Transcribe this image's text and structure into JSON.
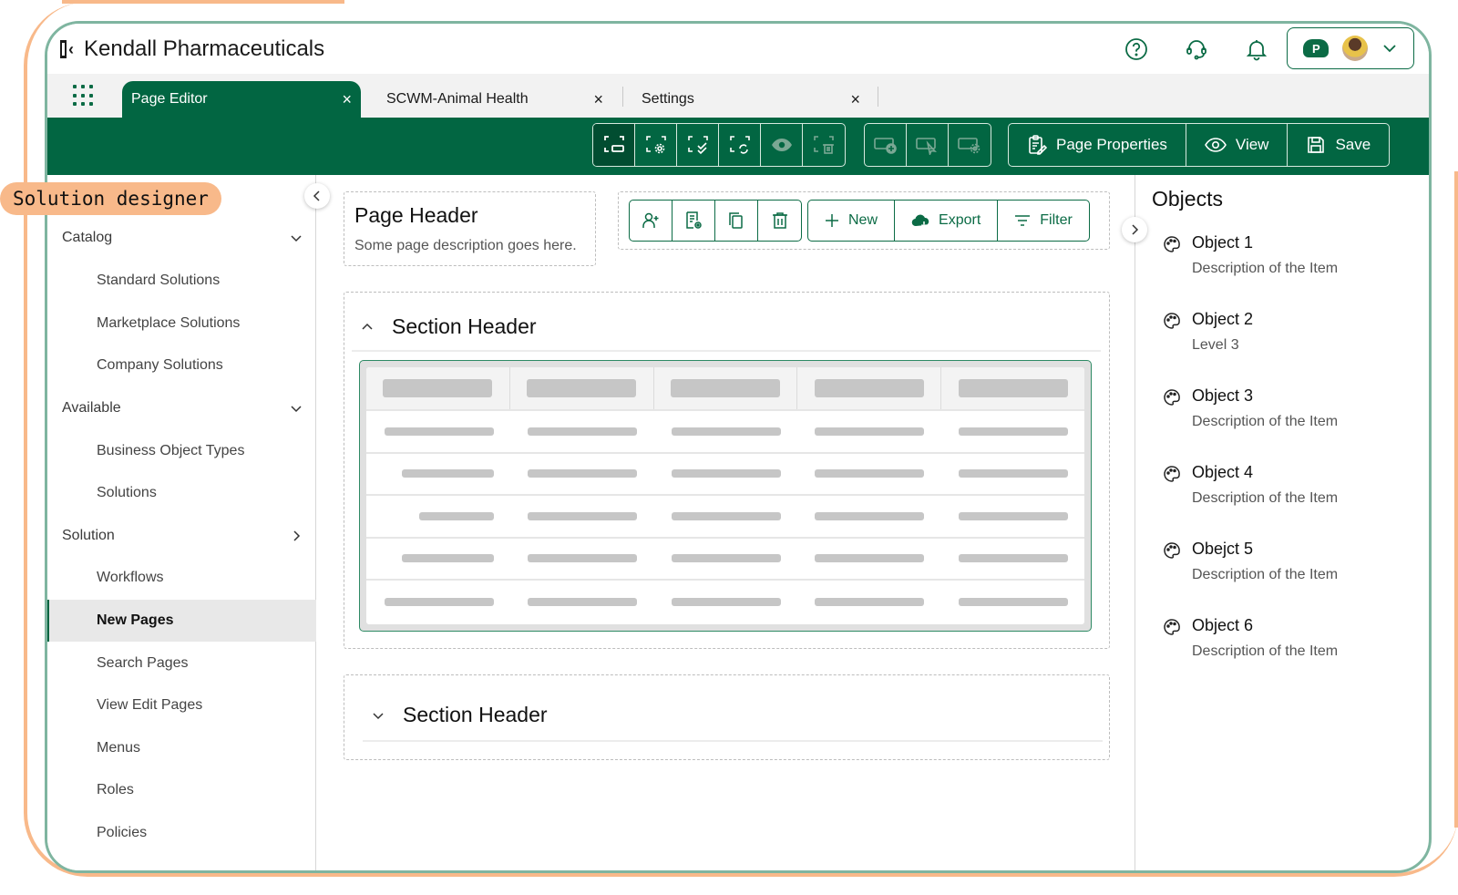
{
  "annotation": {
    "label": "Solution designer"
  },
  "header": {
    "brand": "Kendall Pharmaceuticals",
    "icons": [
      "help-icon",
      "support-headset-icon",
      "notification-bell-icon"
    ],
    "user_menu": {
      "cloud_badge": "P",
      "icon": "chevron-down-icon"
    }
  },
  "tabs": [
    {
      "label": "Page Editor",
      "active": true,
      "close": "×"
    },
    {
      "label": "SCWM-Animal Health",
      "active": false,
      "close": "×"
    },
    {
      "label": "Settings",
      "active": false,
      "close": "×"
    }
  ],
  "toolbar": {
    "layout_tools": [
      "select-field-icon",
      "field-settings-icon",
      "validate-field-icon",
      "refresh-field-icon",
      "preview-eye-icon",
      "delete-field-icon"
    ],
    "button_tools": [
      "add-button-icon",
      "select-button-icon",
      "button-settings-icon"
    ],
    "actions": {
      "page_properties": "Page Properties",
      "view": "View",
      "save": "Save"
    }
  },
  "sidebar": {
    "groups": [
      {
        "label": "Catalog",
        "expanded": true,
        "items": [
          "Standard Solutions",
          "Marketplace Solutions",
          "Company Solutions"
        ]
      },
      {
        "label": "Available",
        "expanded": true,
        "items": [
          "Business Object Types",
          "Solutions"
        ]
      },
      {
        "label": "Solution",
        "expanded": false,
        "items": [
          "Workflows",
          "New Pages",
          "Search Pages",
          "View Edit Pages",
          "Menus",
          "Roles",
          "Policies"
        ]
      }
    ],
    "active_item": "New Pages"
  },
  "page_header": {
    "title": "Page Header",
    "description": "Some page description goes here."
  },
  "page_actions": {
    "icon_buttons": [
      "add-user-icon",
      "document-preview-icon",
      "copy-icon",
      "trash-icon"
    ],
    "new": "New",
    "export": "Export",
    "filter": "Filter"
  },
  "sections": [
    {
      "title": "Section Header",
      "expanded": true,
      "table": {
        "columns": 5,
        "rows": 5
      }
    },
    {
      "title": "Section Header",
      "expanded": false
    }
  ],
  "objects_panel": {
    "title": "Objects",
    "items": [
      {
        "name": "Object 1",
        "description": "Description of the Item"
      },
      {
        "name": "Object 2",
        "description": "Level 3"
      },
      {
        "name": "Object 3",
        "description": "Description of the Item"
      },
      {
        "name": "Object 4",
        "description": "Description of the Item"
      },
      {
        "name": "Obejct 5",
        "description": "Description of the Item"
      },
      {
        "name": "Object 6",
        "description": "Description of the Item"
      }
    ]
  },
  "colors": {
    "brand_green": "#026642",
    "annotation_orange": "#f8b98a",
    "frame_teal": "#7fb5a0"
  }
}
